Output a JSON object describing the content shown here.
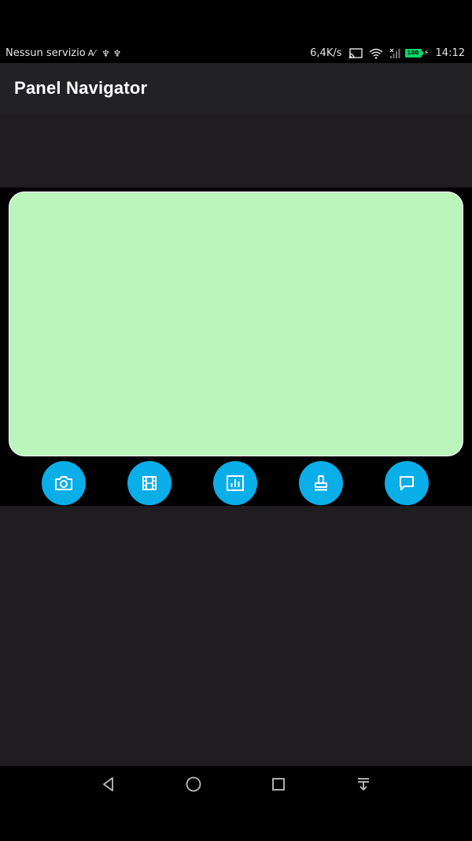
{
  "status_bar": {
    "carrier_text": "Nessun servizio",
    "signal_glyph": "A⁄",
    "usb_glyphs": "♆ ♆",
    "net_speed": "6,4K/s",
    "battery_text": "100",
    "time": "14:12",
    "icons": [
      "cast-icon",
      "wifi-icon",
      "cell-signal-icon",
      "battery-icon",
      "charging-icon"
    ],
    "battery_color": "#00d76a"
  },
  "app_bar": {
    "title": "Panel Navigator",
    "background": "#222124"
  },
  "panel": {
    "color": "#bbf5bc"
  },
  "panel_buttons": [
    {
      "name": "camera-button",
      "icon": "camera-icon"
    },
    {
      "name": "film-button",
      "icon": "film-icon"
    },
    {
      "name": "chart-button",
      "icon": "bar-chart-icon"
    },
    {
      "name": "stamp-button",
      "icon": "stamp-icon"
    },
    {
      "name": "comment-button",
      "icon": "comment-icon"
    }
  ],
  "fab_color": "#0aaee9",
  "nav_bar": {
    "buttons": [
      "back-icon",
      "home-icon",
      "recents-icon",
      "notification-pull-icon"
    ]
  }
}
